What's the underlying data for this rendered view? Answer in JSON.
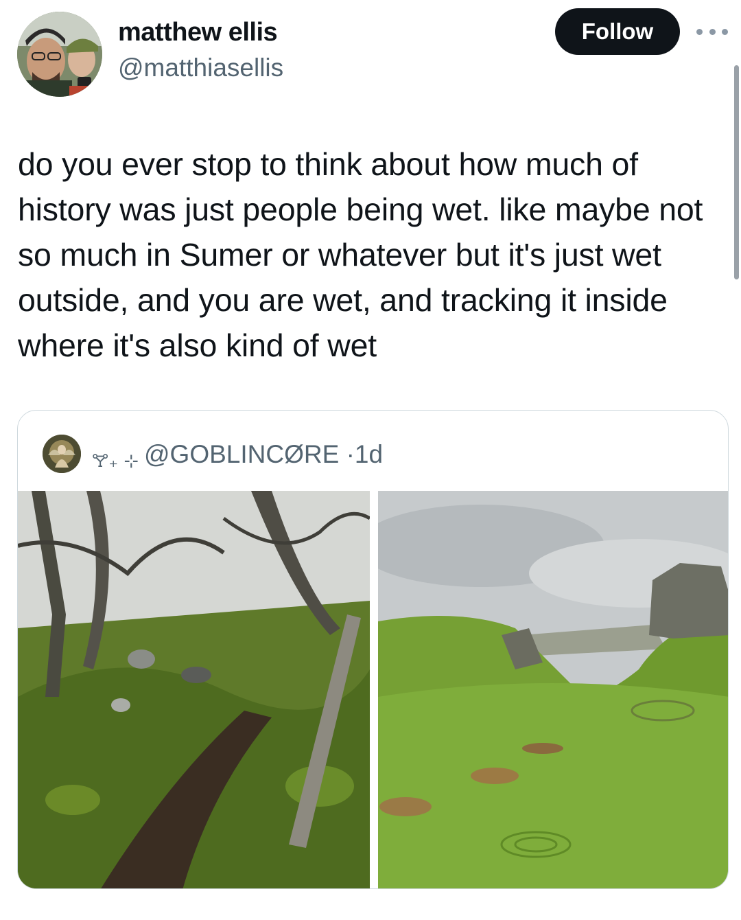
{
  "author": {
    "display_name": "matthew ellis",
    "handle": "@matthiasellis",
    "avatar_icon": "profile-photo-two-people"
  },
  "follow_button": {
    "label": "Follow"
  },
  "more_icon": "ellipsis-icon",
  "tweet": {
    "text": "do you ever stop to think about how much of\nhistory was just people being wet. like maybe not\nso much in Sumer or whatever but it's just wet\noutside, and you are wet, and tracking it inside\nwhere it's also kind of wet"
  },
  "quoted_post": {
    "decoration": "🝖₊ ⊹",
    "handle": "@GOBLINCØRE",
    "separator": "·",
    "age": "1d",
    "images": [
      {
        "icon": "photo-mossy-forest-path"
      },
      {
        "icon": "photo-green-valley-rock"
      }
    ]
  },
  "colors": {
    "text": "#0f1419",
    "secondary": "#536471",
    "button_bg": "#0f1419",
    "border": "#cfd9de"
  }
}
